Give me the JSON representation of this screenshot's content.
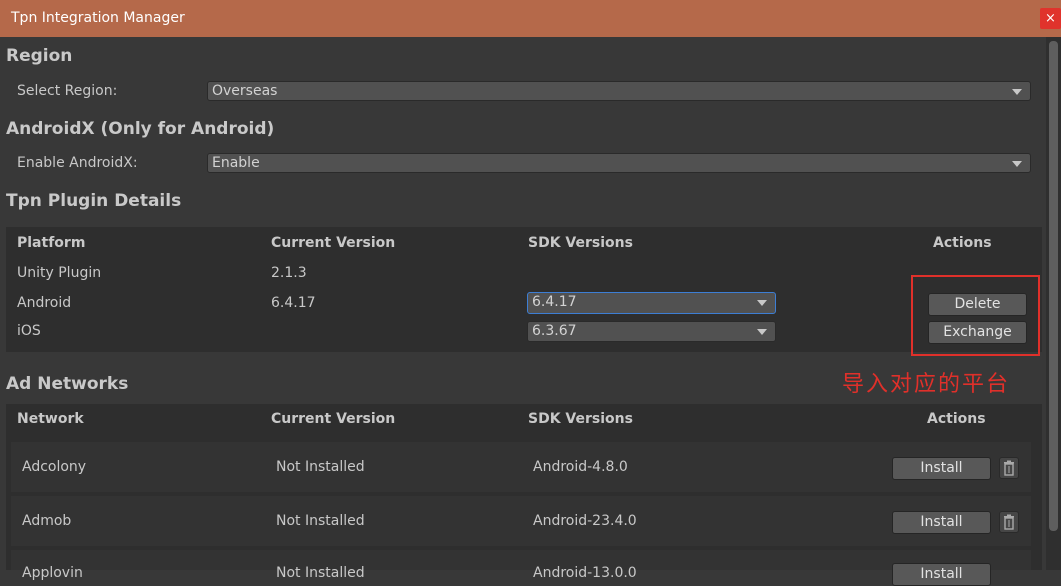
{
  "window": {
    "title": "Tpn Integration Manager",
    "close_glyph": "×"
  },
  "region": {
    "title": "Region",
    "label": "Select Region:",
    "value": "Overseas"
  },
  "androidx": {
    "title": "AndroidX (Only for Android)",
    "label": "Enable AndroidX:",
    "value": "Enable"
  },
  "plugin": {
    "title": "Tpn Plugin Details",
    "headers": {
      "platform": "Platform",
      "current": "Current Version",
      "sdk": "SDK Versions",
      "actions": "Actions"
    },
    "rows": [
      {
        "platform": "Unity Plugin",
        "current": "2.1.3"
      },
      {
        "platform": "Android",
        "current": "6.4.17",
        "sdk": "6.4.17"
      },
      {
        "platform": "iOS",
        "sdk": "6.3.67"
      }
    ],
    "delete_label": "Delete",
    "exchange_label": "Exchange"
  },
  "annotation": "导入对应的平台",
  "networks": {
    "title": "Ad Networks",
    "headers": {
      "network": "Network",
      "current": "Current Version",
      "sdk": "SDK Versions",
      "actions": "Actions"
    },
    "rows": [
      {
        "name": "Adcolony",
        "current": "Not Installed",
        "sdk": "Android-4.8.0",
        "action": "Install"
      },
      {
        "name": "Admob",
        "current": "Not Installed",
        "sdk": "Android-23.4.0",
        "action": "Install"
      },
      {
        "name": "Applovin",
        "current": "Not Installed",
        "sdk": "Android-13.0.0",
        "action": "Install"
      }
    ]
  },
  "icons": {
    "trash": "trash-icon",
    "dropdown": "dropdown-arrow-icon",
    "close": "close-icon"
  },
  "colors": {
    "titlebar": "#b5694a",
    "background": "#383838",
    "highlight": "#e0302a",
    "focus": "#3d7ed4"
  }
}
